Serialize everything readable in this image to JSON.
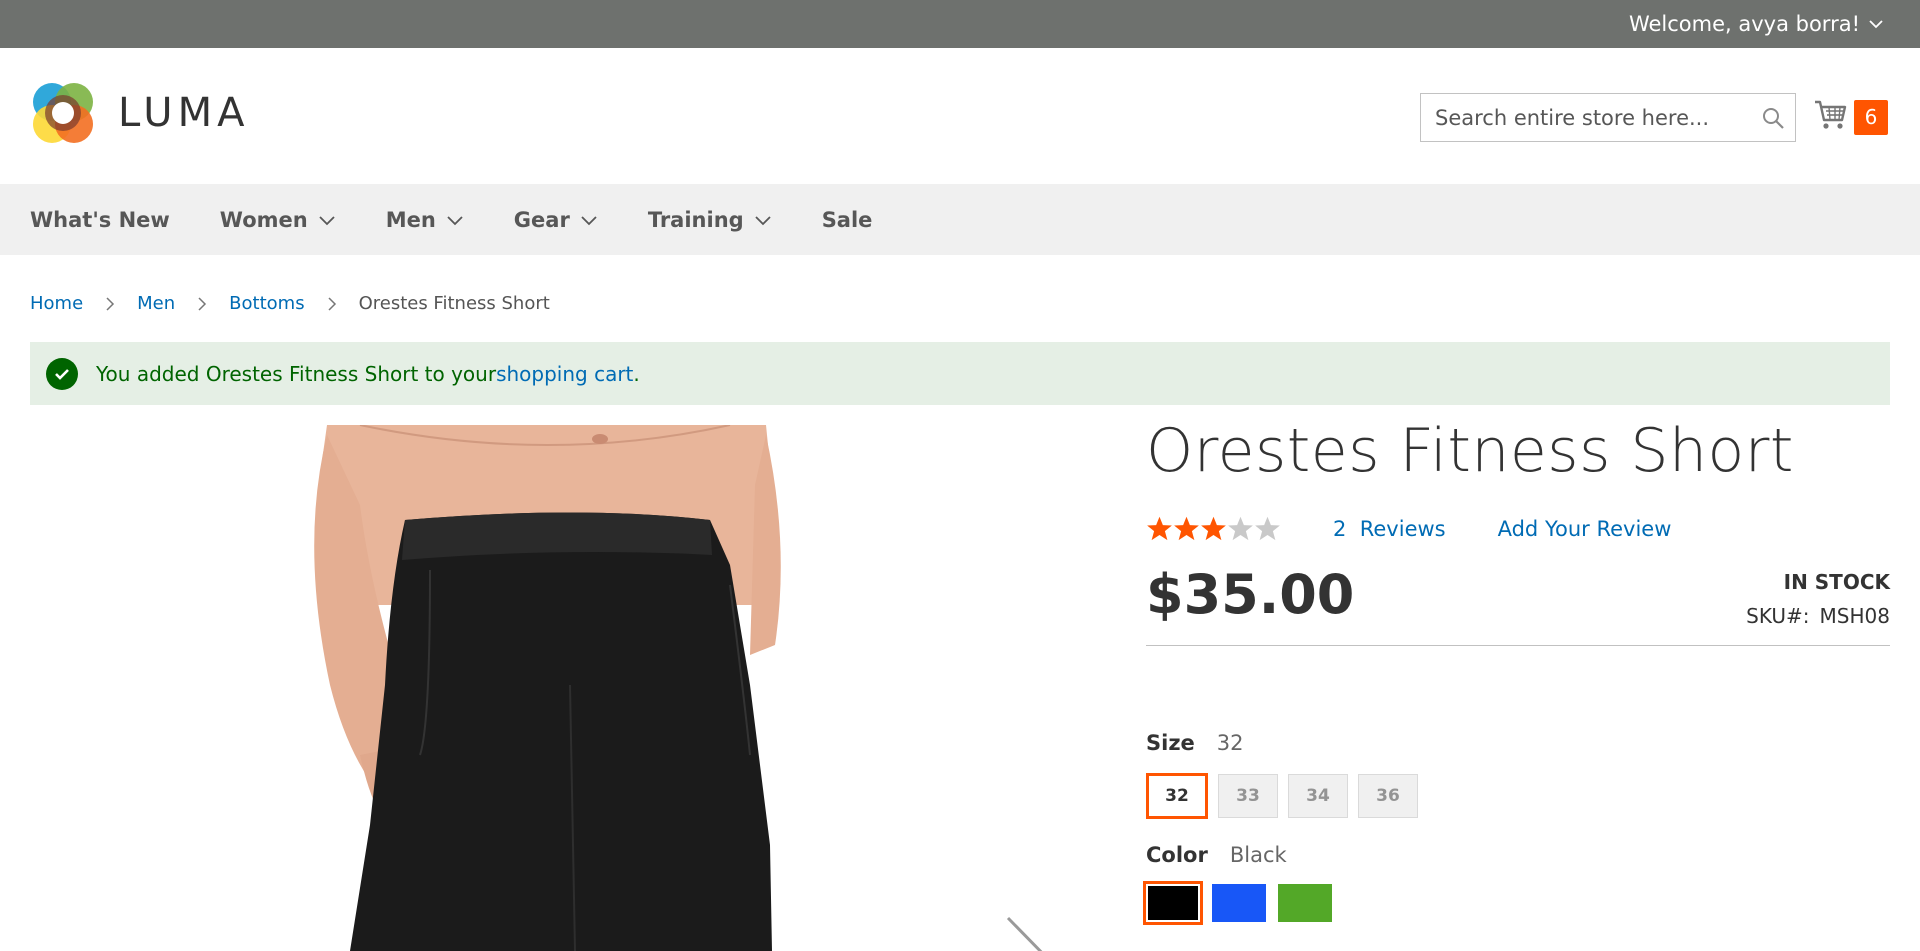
{
  "topbar": {
    "welcome": "Welcome, avya borra!"
  },
  "header": {
    "logo_text": "LUMA",
    "search_placeholder": "Search entire store here...",
    "cart_count": "6"
  },
  "nav": {
    "items": [
      {
        "label": "What's New",
        "has_dropdown": false
      },
      {
        "label": "Women",
        "has_dropdown": true
      },
      {
        "label": "Men",
        "has_dropdown": true
      },
      {
        "label": "Gear",
        "has_dropdown": true
      },
      {
        "label": "Training",
        "has_dropdown": true
      },
      {
        "label": "Sale",
        "has_dropdown": false
      }
    ]
  },
  "breadcrumbs": {
    "items": [
      "Home",
      "Men",
      "Bottoms"
    ],
    "current": "Orestes Fitness Short"
  },
  "message": {
    "prefix": "You added Orestes Fitness Short to your ",
    "link": "shopping cart",
    "suffix": "."
  },
  "product": {
    "title": "Orestes Fitness Short",
    "rating_stars": 3,
    "rating_max": 5,
    "reviews_count": "2",
    "reviews_label": "Reviews",
    "add_review": "Add Your Review",
    "price": "$35.00",
    "stock": "IN STOCK",
    "sku_label": "SKU#:",
    "sku": "MSH08",
    "size_label": "Size",
    "size_selected": "32",
    "sizes": [
      "32",
      "33",
      "34",
      "36"
    ],
    "color_label": "Color",
    "color_selected": "Black",
    "colors": [
      {
        "name": "Black",
        "hex": "#000000"
      },
      {
        "name": "Blue",
        "hex": "#1857f7"
      },
      {
        "name": "Green",
        "hex": "#53a828"
      }
    ]
  },
  "theme": {
    "accent": "#ff5501",
    "link": "#006bb4",
    "topbar": "#6e716e",
    "nav_bg": "#f0f0f0"
  }
}
